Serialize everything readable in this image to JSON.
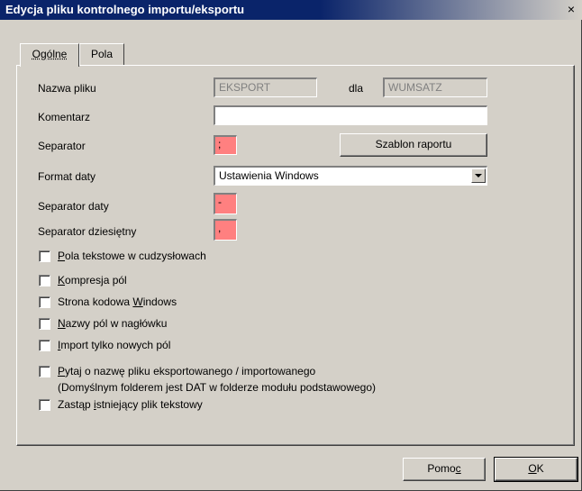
{
  "window": {
    "title": "Edycja pliku kontrolnego importu/eksportu",
    "close_symbol": "×"
  },
  "tabs": [
    {
      "label": "Ogólne",
      "active": true
    },
    {
      "label": "Pola",
      "active": false
    }
  ],
  "form": {
    "nazwa_pliku": {
      "label": "Nazwa pliku",
      "value": "EKSPORT"
    },
    "dla": {
      "label": "dla",
      "value": "WUMSATZ"
    },
    "komentarz": {
      "label": "Komentarz",
      "value": ""
    },
    "separator": {
      "label": "Separator",
      "value": ";"
    },
    "szablon_button": "Szablon raportu",
    "format_daty": {
      "label": "Format daty",
      "value": "Ustawienia Windows"
    },
    "separator_daty": {
      "label": "Separator daty",
      "value": "-"
    },
    "separator_dziesietny": {
      "label": "Separator dziesiętny",
      "value": ","
    }
  },
  "checkboxes": [
    {
      "pre": "",
      "u": "P",
      "post": "ola tekstowe w cudzysłowach",
      "checked": false
    },
    {
      "pre": "",
      "u": "K",
      "post": "ompresja pól",
      "checked": false
    },
    {
      "pre": "Strona kodowa ",
      "u": "W",
      "post": "indows",
      "checked": false
    },
    {
      "pre": "",
      "u": "N",
      "post": "azwy pól w nagłówku",
      "checked": false
    },
    {
      "pre": "",
      "u": "I",
      "post": "mport tylko nowych pól",
      "checked": false
    },
    {
      "pre": "",
      "u": "P",
      "post": "ytaj o nazwę pliku eksportowanego / importowanego",
      "checked": false
    },
    {
      "pre": "Zastąp ",
      "u": "i",
      "post": "stniejący plik tekstowy",
      "checked": false
    }
  ],
  "checkbox_note": "(Domyślnym folderem jest DAT w folderze modułu podstawowego)",
  "buttons": {
    "pomoc": {
      "pre": "Pomo",
      "u": "c",
      "post": ""
    },
    "ok": {
      "pre": "",
      "u": "O",
      "post": "K"
    }
  },
  "colors": {
    "titlebar": "#0a246a",
    "face": "#d4d0c8",
    "separator_field": "#ff8080"
  }
}
